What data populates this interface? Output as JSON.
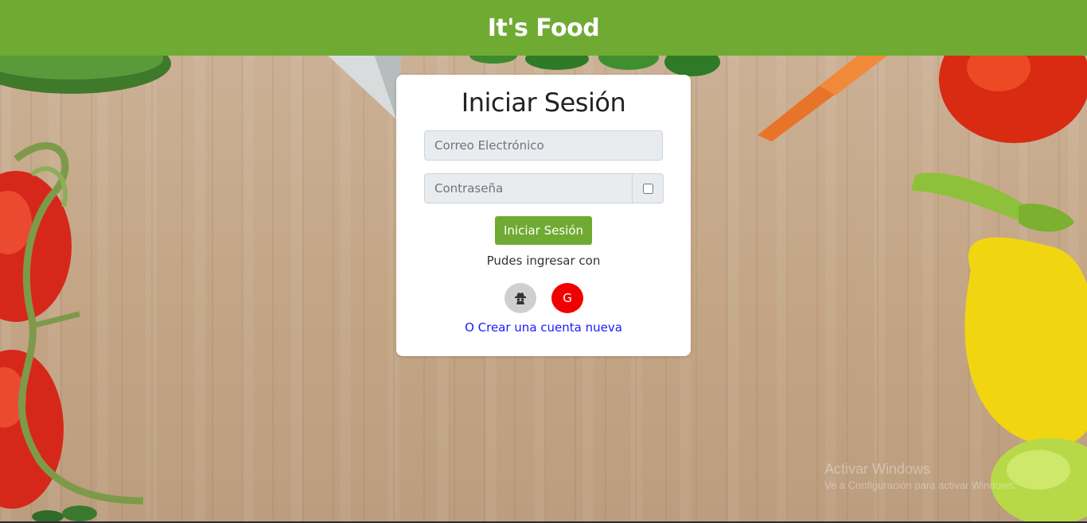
{
  "header": {
    "brand": "It's Food"
  },
  "login": {
    "title": "Iniciar Sesión",
    "email_placeholder": "Correo Electrónico",
    "password_placeholder": "Contraseña",
    "submit_label": "Iniciar Sesión",
    "alt_text": "Pudes ingresar con",
    "social": [
      {
        "icon": "anonymous-icon"
      },
      {
        "icon": "google-icon",
        "label": "G"
      }
    ],
    "create_account_label": "O Crear una cuenta nueva"
  },
  "watermark": {
    "title": "Activar Windows",
    "subtitle": "Ve a Configuración para activar Windows."
  },
  "colors": {
    "brand_green": "#6fab32",
    "google_red": "#f10000",
    "link_blue": "#1a1aff"
  }
}
